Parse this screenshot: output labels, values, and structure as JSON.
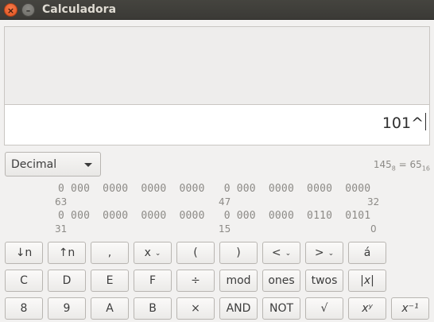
{
  "window": {
    "title": "Calculadora",
    "close_glyph": "×",
    "min_glyph": "–"
  },
  "display": {
    "expression": "101^"
  },
  "mode": {
    "selected": "Decimal"
  },
  "conversion": {
    "left": "145",
    "left_base": "8",
    "equals": " = ",
    "right": "65",
    "right_base": "16"
  },
  "bits": {
    "row1": "0 000  0000  0000  0000   0 000  0000  0000  0000",
    "row1_left_index": "63",
    "row1_mid_index": "47",
    "row1_right_index": "32",
    "row2": "0 000  0000  0000  0000   0 000  0000  0110  0101",
    "row2_left_index": "31",
    "row2_mid_index": "15",
    "row2_right_index": "0"
  },
  "buttons": {
    "row1": [
      "↓n",
      "↑n",
      ",",
      "x",
      "(",
      ")",
      "<",
      ">",
      "á"
    ],
    "row2": [
      "C",
      "D",
      "E",
      "F",
      "÷",
      "mod",
      "ones",
      "twos",
      "|x|"
    ],
    "row3": [
      "8",
      "9",
      "A",
      "B",
      "×",
      "AND",
      "NOT",
      "√",
      "xʸ",
      "x⁻¹"
    ],
    "dropdown_glyph": "⌄"
  }
}
